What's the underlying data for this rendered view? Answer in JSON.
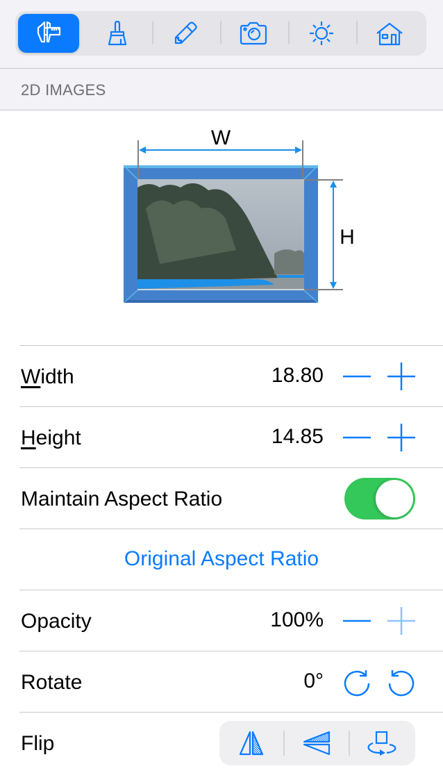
{
  "toolbar": {
    "items": [
      {
        "name": "measure",
        "icon": "caliper-icon",
        "active": true
      },
      {
        "name": "brush",
        "icon": "brush-icon",
        "active": false
      },
      {
        "name": "pencil",
        "icon": "pencil-icon",
        "active": false
      },
      {
        "name": "camera",
        "icon": "camera-icon",
        "active": false
      },
      {
        "name": "light",
        "icon": "sun-icon",
        "active": false
      },
      {
        "name": "home",
        "icon": "house-icon",
        "active": false
      }
    ]
  },
  "section": {
    "title": "2D IMAGES"
  },
  "diagram": {
    "width_label": "W",
    "height_label": "H"
  },
  "rows": {
    "width": {
      "label_prefix": "",
      "label_underlined": "W",
      "label_rest": "idth",
      "value": "18.80"
    },
    "height": {
      "label_underlined": "H",
      "label_rest": "eight",
      "value": "14.85"
    },
    "aspect": {
      "label": "Maintain Aspect Ratio",
      "on": true
    },
    "original": {
      "label": "Original Aspect Ratio"
    },
    "opacity": {
      "label": "Opacity",
      "value": "100%",
      "plus_enabled": false
    },
    "rotate": {
      "label": "Rotate",
      "value": "0°"
    },
    "flip": {
      "label": "Flip"
    }
  },
  "colors": {
    "accent": "#0a7bff",
    "toggle_on": "#34c759",
    "frame": "#4481cc"
  }
}
